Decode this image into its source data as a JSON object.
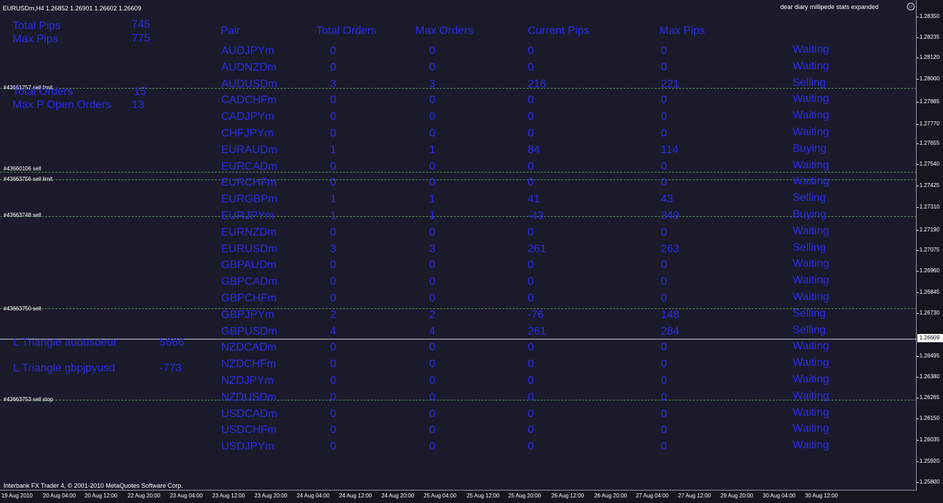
{
  "window": {
    "header_info": "EURUSDm,H4  1.26852 1.26901 1.26602 1.26609",
    "indicator_name": "dear diary millipede stats expanded",
    "copyright": "Interbank FX Trader 4, © 2001-2010 MetaQuotes Software Corp."
  },
  "stats": {
    "total_pips_label": "Total Pips",
    "total_pips_value": "745",
    "max_pips_label": "Max Pips",
    "max_pips_value": "775",
    "total_orders_label": "Total Orders",
    "total_orders_value": "15",
    "max_p_open_orders_label": "Max P Open Orders",
    "max_p_open_orders_value": "13",
    "triangle1_label": "L Triangle audusdeur",
    "triangle1_value": "5666",
    "triangle2_label": "L Triangle gbpjpyusd",
    "triangle2_value": "-773"
  },
  "table": {
    "headers": [
      "Pair",
      "Total Orders",
      "Max Orders",
      "Current Pips",
      "Max Pips"
    ],
    "rows": [
      {
        "pair": "AUDJPYm",
        "total": "0",
        "max": "0",
        "current": "0",
        "maxpips": "0",
        "status": "Waiting"
      },
      {
        "pair": "AUDNZDm",
        "total": "0",
        "max": "0",
        "current": "0",
        "maxpips": "0",
        "status": "Waiting"
      },
      {
        "pair": "AUDUSDm",
        "total": "3",
        "max": "3",
        "current": "216",
        "maxpips": "221",
        "status": "Selling"
      },
      {
        "pair": "CADCHFm",
        "total": "0",
        "max": "0",
        "current": "0",
        "maxpips": "0",
        "status": "Waiting"
      },
      {
        "pair": "CADJPYm",
        "total": "0",
        "max": "0",
        "current": "0",
        "maxpips": "0",
        "status": "Waiting"
      },
      {
        "pair": "CHFJPYm",
        "total": "0",
        "max": "0",
        "current": "0",
        "maxpips": "0",
        "status": "Waiting"
      },
      {
        "pair": "EURAUDm",
        "total": "1",
        "max": "1",
        "current": "84",
        "maxpips": "114",
        "status": "Buying"
      },
      {
        "pair": "EURCADm",
        "total": "0",
        "max": "0",
        "current": "0",
        "maxpips": "0",
        "status": "Waiting"
      },
      {
        "pair": "EURCHFm",
        "total": "0",
        "max": "0",
        "current": "0",
        "maxpips": "0",
        "status": "Waiting"
      },
      {
        "pair": "EURGBPm",
        "total": "1",
        "max": "1",
        "current": "41",
        "maxpips": "43",
        "status": "Selling"
      },
      {
        "pair": "EURJPYm",
        "total": "1",
        "max": "1",
        "current": "-43",
        "maxpips": "349",
        "status": "Buying"
      },
      {
        "pair": "EURNZDm",
        "total": "0",
        "max": "0",
        "current": "0",
        "maxpips": "0",
        "status": "Waiting"
      },
      {
        "pair": "EURUSDm",
        "total": "3",
        "max": "3",
        "current": "261",
        "maxpips": "263",
        "status": "Selling"
      },
      {
        "pair": "GBPAUDm",
        "total": "0",
        "max": "0",
        "current": "0",
        "maxpips": "0",
        "status": "Waiting"
      },
      {
        "pair": "GBPCADm",
        "total": "0",
        "max": "0",
        "current": "0",
        "maxpips": "0",
        "status": "Waiting"
      },
      {
        "pair": "GBPCHFm",
        "total": "0",
        "max": "0",
        "current": "0",
        "maxpips": "0",
        "status": "Waiting"
      },
      {
        "pair": "GBPJPYm",
        "total": "2",
        "max": "2",
        "current": "-76",
        "maxpips": "148",
        "status": "Selling"
      },
      {
        "pair": "GBPUSDm",
        "total": "4",
        "max": "4",
        "current": "261",
        "maxpips": "284",
        "status": "Selling"
      },
      {
        "pair": "NZDCADm",
        "total": "0",
        "max": "0",
        "current": "0",
        "maxpips": "0",
        "status": "Waiting"
      },
      {
        "pair": "NZDCHFm",
        "total": "0",
        "max": "0",
        "current": "0",
        "maxpips": "0",
        "status": "Waiting"
      },
      {
        "pair": "NZDJPYm",
        "total": "0",
        "max": "0",
        "current": "0",
        "maxpips": "0",
        "status": "Waiting"
      },
      {
        "pair": "NZDUSDm",
        "total": "0",
        "max": "0",
        "current": "0",
        "maxpips": "0",
        "status": "Waiting"
      },
      {
        "pair": "USDCADm",
        "total": "0",
        "max": "0",
        "current": "0",
        "maxpips": "0",
        "status": "Waiting"
      },
      {
        "pair": "USDCHFm",
        "total": "0",
        "max": "0",
        "current": "0",
        "maxpips": "0",
        "status": "Waiting"
      },
      {
        "pair": "USDJPYm",
        "total": "0",
        "max": "0",
        "current": "0",
        "maxpips": "0",
        "status": "Waiting"
      }
    ]
  },
  "order_lines": [
    "#43661757 sell limit",
    "#43660106 sell",
    "#43663756 sell limit",
    "#43663748 sell",
    "#43663750 sell",
    "#43663753 sell stop"
  ],
  "price_axis": [
    "1.28350",
    "1.28235",
    "1.28120",
    "1.28000",
    "1.27885",
    "1.27770",
    "1.27655",
    "1.27540",
    "1.27425",
    "1.27310",
    "1.27190",
    "1.27075",
    "1.26960",
    "1.26845",
    "1.26730",
    "1.26495",
    "1.26380",
    "1.26265",
    "1.26150",
    "1.26035",
    "1.25920",
    "1.25800"
  ],
  "current_price": "1.26609",
  "time_axis": [
    "19 Aug 2010",
    "20 Aug 04:00",
    "20 Aug 12:00",
    "22 Aug 20:00",
    "23 Aug 04:00",
    "23 Aug 12:00",
    "23 Aug 20:00",
    "24 Aug 04:00",
    "24 Aug 12:00",
    "24 Aug 20:00",
    "25 Aug 04:00",
    "25 Aug 12:00",
    "25 Aug 20:00",
    "26 Aug 12:00",
    "26 Aug 20:00",
    "27 Aug 04:00",
    "27 Aug 12:00",
    "29 Aug 20:00",
    "30 Aug 04:00",
    "30 Aug 12:00"
  ],
  "colors": {
    "text_blue": "#2a2ae8",
    "background": "#1b1b2b",
    "order_line": "#5b8c5b"
  }
}
